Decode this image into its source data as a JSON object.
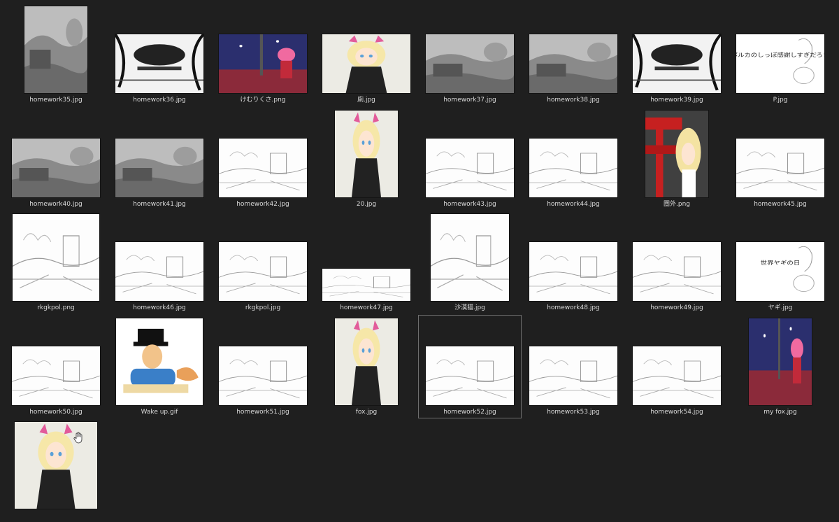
{
  "files": [
    {
      "name": "homework35.jpg",
      "style": "gray",
      "aspect": "tall"
    },
    {
      "name": "homework36.jpg",
      "style": "bw",
      "aspect": "wide"
    },
    {
      "name": "けむりくさ.png",
      "style": "color-night",
      "aspect": "wide"
    },
    {
      "name": "廁.jpg",
      "style": "color-anime",
      "aspect": "wide"
    },
    {
      "name": "homework37.jpg",
      "style": "gray",
      "aspect": "wide"
    },
    {
      "name": "homework38.jpg",
      "style": "gray",
      "aspect": "wide"
    },
    {
      "name": "homework39.jpg",
      "style": "bw",
      "aspect": "wide"
    },
    {
      "name": "P.jpg",
      "style": "sketch-text",
      "aspect": "wide"
    },
    {
      "name": "homework40.jpg",
      "style": "gray",
      "aspect": "wide"
    },
    {
      "name": "homework41.jpg",
      "style": "gray",
      "aspect": "wide"
    },
    {
      "name": "homework42.jpg",
      "style": "sketch",
      "aspect": "wide"
    },
    {
      "name": "20.jpg",
      "style": "color-anime",
      "aspect": "tall"
    },
    {
      "name": "homework43.jpg",
      "style": "sketch",
      "aspect": "wide"
    },
    {
      "name": "homework44.jpg",
      "style": "sketch",
      "aspect": "wide"
    },
    {
      "name": "圏外.png",
      "style": "color-red",
      "aspect": "tall"
    },
    {
      "name": "homework45.jpg",
      "style": "sketch",
      "aspect": "wide"
    },
    {
      "name": "rkgkpol.png",
      "style": "sketch",
      "aspect": "square"
    },
    {
      "name": "homework46.jpg",
      "style": "sketch",
      "aspect": "wide"
    },
    {
      "name": "rkgkpol.jpg",
      "style": "sketch",
      "aspect": "wide"
    },
    {
      "name": "homework47.jpg",
      "style": "sketch",
      "aspect": "strip"
    },
    {
      "name": "沙漠猫.jpg",
      "style": "sketch",
      "aspect": "tallsquare"
    },
    {
      "name": "homework48.jpg",
      "style": "sketch",
      "aspect": "wide"
    },
    {
      "name": "homework49.jpg",
      "style": "sketch",
      "aspect": "wide"
    },
    {
      "name": "ヤギ.jpg",
      "style": "sketch-text",
      "aspect": "wide"
    },
    {
      "name": "homework50.jpg",
      "style": "sketch",
      "aspect": "wide"
    },
    {
      "name": "Wake up.gif",
      "style": "color-cartoon",
      "aspect": "square"
    },
    {
      "name": "homework51.jpg",
      "style": "sketch",
      "aspect": "wide"
    },
    {
      "name": "fox.jpg",
      "style": "color-anime",
      "aspect": "tall"
    },
    {
      "name": "homework52.jpg",
      "style": "sketch",
      "aspect": "wide",
      "selected": true
    },
    {
      "name": "homework53.jpg",
      "style": "sketch",
      "aspect": "wide"
    },
    {
      "name": "homework54.jpg",
      "style": "sketch",
      "aspect": "wide"
    },
    {
      "name": "my fox.jpg",
      "style": "color-night",
      "aspect": "tall"
    },
    {
      "name": "",
      "style": "color-anime",
      "aspect": "tallcrop"
    }
  ],
  "thumb_text": {
    "P.jpg": "ポルカのしっぽ感謝しすぎだろ！",
    "ヤギ.jpg": "世界ヤギの日"
  },
  "colors": {
    "background": "#1f1f1f",
    "label": "#d9d9d9",
    "selection_border": "#6e6e6e"
  },
  "icons": {
    "cursor": "hand-cursor-icon"
  }
}
